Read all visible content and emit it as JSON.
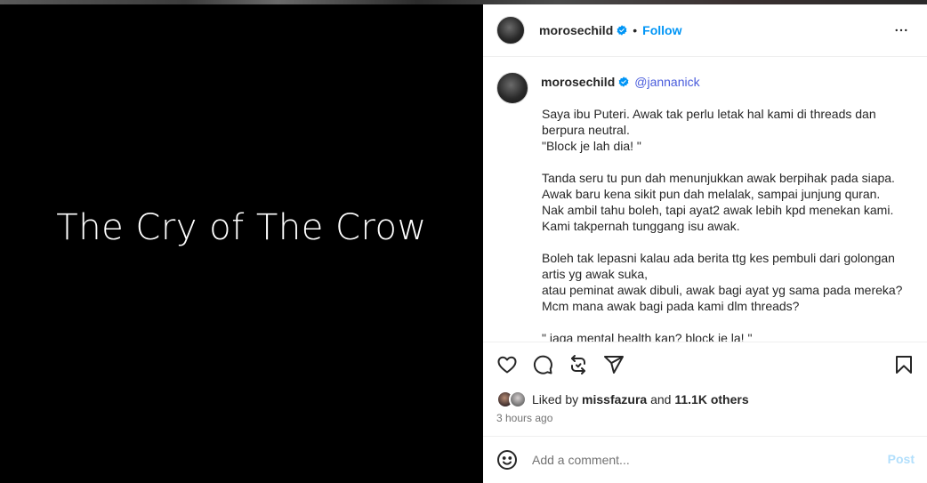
{
  "media": {
    "title": "The Cry of The Crow"
  },
  "header": {
    "username": "morosechild",
    "separator": "•",
    "follow_label": "Follow"
  },
  "caption": {
    "username": "morosechild",
    "mention": "@jannanick",
    "paragraphs": [
      [
        "Saya ibu Puteri. Awak tak perlu letak hal kami di threads dan",
        "berpura neutral.",
        "\"Block je lah dia! \""
      ],
      [
        "Tanda seru tu pun dah menunjukkan awak berpihak pada siapa.",
        "Awak baru kena sikit pun dah melalak, sampai junjung quran.",
        "Nak ambil tahu boleh, tapi ayat2 awak lebih kpd menekan kami.",
        "Kami takpernah tunggang isu awak."
      ],
      [
        "Boleh tak lepasni kalau ada berita ttg kes pembuli dari golongan",
        "artis yg awak suka,",
        "atau peminat awak dibuli, awak bagi ayat yg sama pada mereka?",
        "Mcm mana awak bagi pada kami dlm threads?"
      ],
      [
        "\" jaga mental health kan? block je la! \""
      ]
    ]
  },
  "likes": {
    "prefix": "Liked by",
    "user": "missfazura",
    "and": "and",
    "others": "11.1K others"
  },
  "time": "3 hours ago",
  "comment": {
    "placeholder": "Add a comment...",
    "post_label": "Post"
  },
  "colors": {
    "accent": "#0095f6",
    "verified": "#0095f6",
    "post_disabled": "#b2dffc"
  },
  "icons": [
    "verified-badge-icon",
    "more-options-icon",
    "heart-icon",
    "comment-icon",
    "repost-icon",
    "share-icon",
    "bookmark-icon",
    "emoji-icon"
  ]
}
